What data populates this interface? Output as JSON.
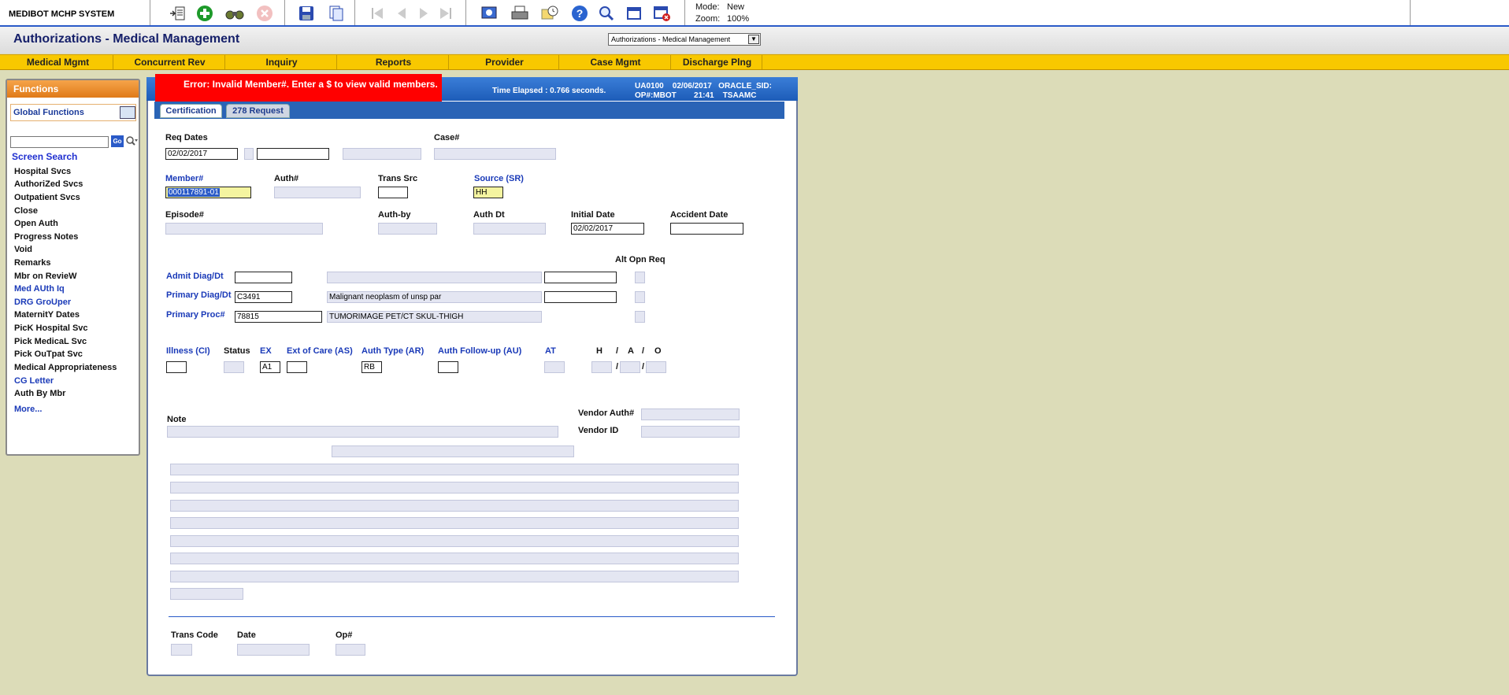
{
  "app": {
    "system_name": "MEDIBOT MCHP SYSTEM",
    "mode_label": "Mode:",
    "mode_value": "New",
    "zoom_label": "Zoom:",
    "zoom_value": "100%"
  },
  "toolbar": {
    "icons": [
      "list-icon",
      "add-icon",
      "binoculars-icon",
      "cancel-icon",
      "save-icon",
      "copy-icon",
      "first-record-icon",
      "prev-record-icon",
      "next-record-icon",
      "last-record-icon",
      "screen-icon",
      "print-icon",
      "notes-clock-icon",
      "help-icon",
      "zoom-icon",
      "window-icon",
      "close-window-icon"
    ]
  },
  "header": {
    "title": "Authorizations - Medical Management",
    "screen_select": "Authorizations - Medical Management"
  },
  "menu": [
    "Medical Mgmt",
    "Concurrent Rev",
    "Inquiry",
    "Reports",
    "Provider",
    "Case Mgmt",
    "Discharge Plng"
  ],
  "functions": {
    "title": "Functions",
    "global": "Global Functions",
    "go": "Go",
    "screen_search": "Screen Search",
    "items": [
      {
        "label": "Hospital Svcs",
        "blue": false
      },
      {
        "label": "AuthoriZed Svcs",
        "blue": false
      },
      {
        "label": "Outpatient Svcs",
        "blue": false
      },
      {
        "label": "Close",
        "blue": false
      },
      {
        "label": "Open Auth",
        "blue": false
      },
      {
        "label": "Progress Notes",
        "blue": false
      },
      {
        "label": "Void",
        "blue": false
      },
      {
        "label": "Remarks",
        "blue": false
      },
      {
        "label": "Mbr on RevieW",
        "blue": false
      },
      {
        "label": "Med AUth Iq",
        "blue": true
      },
      {
        "label": "DRG GroUper",
        "blue": true
      },
      {
        "label": "MaternitY Dates",
        "blue": false
      },
      {
        "label": "PicK Hospital Svc",
        "blue": false
      },
      {
        "label": "Pick MedicaL Svc",
        "blue": false
      },
      {
        "label": "Pick OuTpat Svc",
        "blue": false
      },
      {
        "label": "Medical Appropriateness",
        "blue": false
      },
      {
        "label": "CG Letter",
        "blue": true
      },
      {
        "label": "Auth By Mbr",
        "blue": false
      }
    ],
    "more": "More..."
  },
  "status": {
    "error": "Error: Invalid Member#. Enter a $ to view valid members.",
    "elapsed": "Time Elapsed : 0.766 seconds.",
    "info": "UA0100    02/06/2017   ORACLE_SID:\nOP#:MBOT        21:41    TSAAMC"
  },
  "tabs": {
    "certification": "Certification",
    "request": "278 Request"
  },
  "form": {
    "labels": {
      "req_dates": "Req Dates",
      "case": "Case#",
      "member": "Member#",
      "auth": "Auth#",
      "trans_src": "Trans Src",
      "source": "Source (SR)",
      "episode": "Episode#",
      "auth_by": "Auth-by",
      "auth_dt": "Auth Dt",
      "initial_date": "Initial Date",
      "accident_date": "Accident Date",
      "alt_opn_req": "Alt Opn Req",
      "admit_diag": "Admit Diag/Dt",
      "primary_diag": "Primary Diag/Dt",
      "primary_proc": "Primary Proc#",
      "illness": "Illness (CI)",
      "status": "Status",
      "ex": "EX",
      "ext_care": "Ext of Care (AS)",
      "auth_type": "Auth Type (AR)",
      "auth_followup": "Auth Follow-up (AU)",
      "at": "AT",
      "h": "H",
      "a": "A",
      "o": "O",
      "note": "Note",
      "vendor_auth": "Vendor Auth#",
      "vendor_id": "Vendor ID",
      "trans_code": "Trans Code",
      "date": "Date",
      "op": "Op#"
    },
    "values": {
      "req_date_from": "02/02/2017",
      "member": "000117891-01",
      "source": "HH",
      "initial_date": "02/02/2017",
      "primary_diag_code": "C3491",
      "primary_diag_desc": "Malignant neoplasm of unsp par",
      "primary_proc_code": "78815",
      "primary_proc_desc": "TUMORIMAGE PET/CT SKUL-THIGH",
      "ex": "A1",
      "auth_type": "RB",
      "slash": "/"
    }
  },
  "colors": {
    "menubar": "#f8c800",
    "header_blue": "#1d5cb8",
    "error_red": "#ff0000",
    "func_orange": "#e88a2a",
    "field_bg": "#e4e6f2",
    "page_bg": "#dcdcb8"
  }
}
